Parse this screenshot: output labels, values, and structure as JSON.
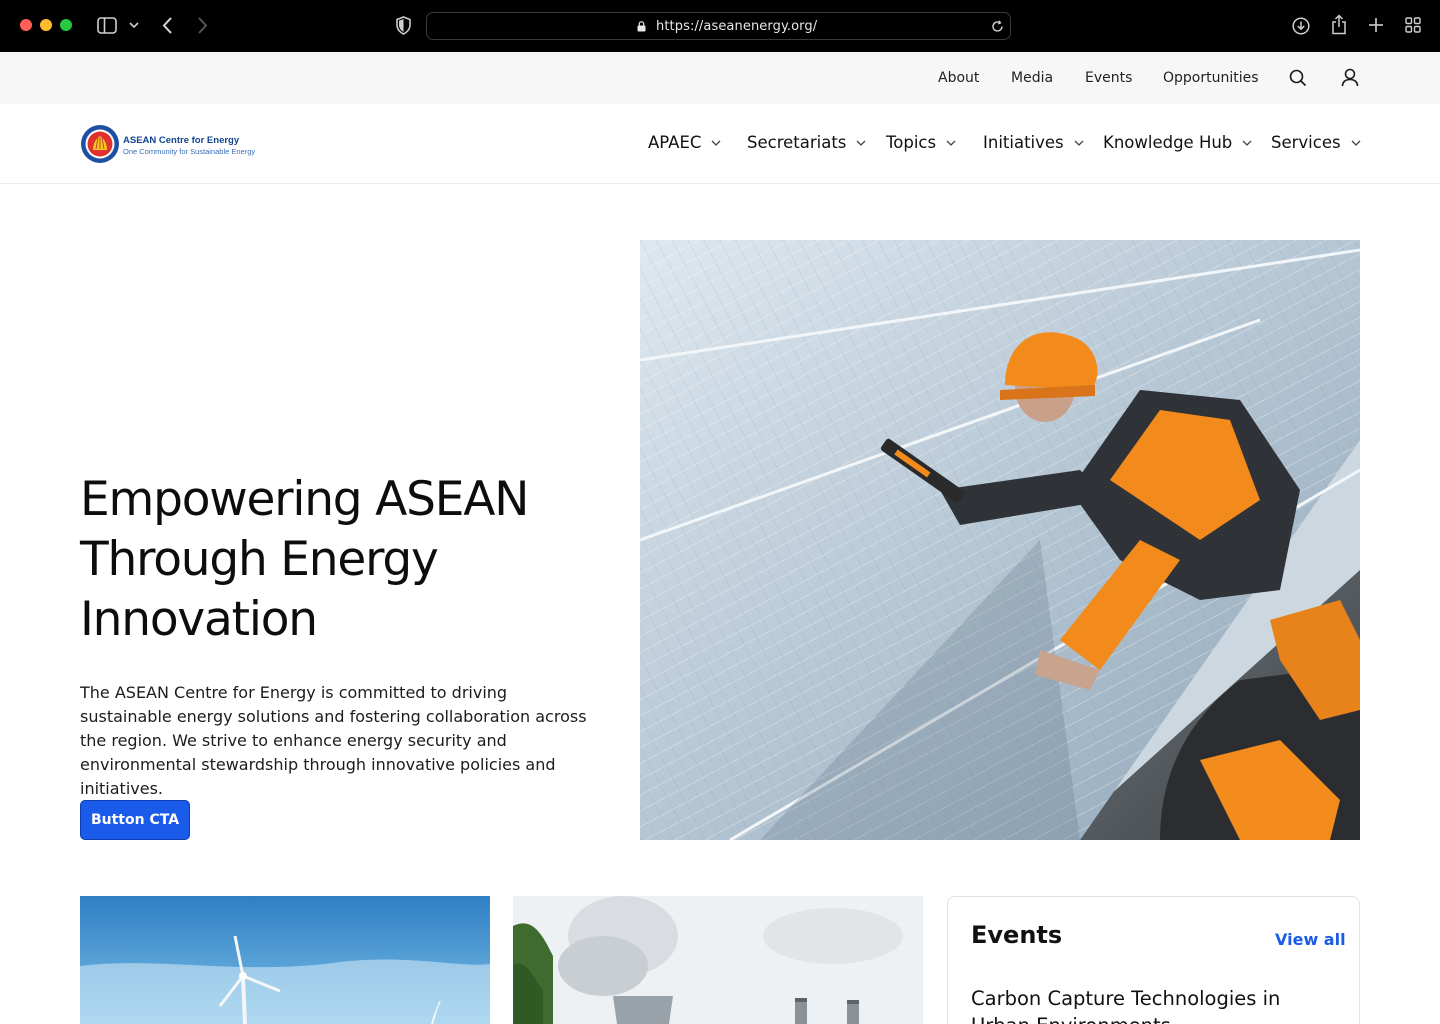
{
  "browser": {
    "url": "https://aseanenergy.org/",
    "icons": [
      "sidebar-icon",
      "chevron-down-icon",
      "back-icon",
      "forward-icon",
      "shield-icon",
      "lock-icon",
      "reload-icon",
      "download-icon",
      "share-icon",
      "plus-icon",
      "tabs-icon"
    ]
  },
  "utility_nav": {
    "items": [
      "About",
      "Media",
      "Events",
      "Opportunities"
    ],
    "icons": [
      "search-icon",
      "user-icon"
    ]
  },
  "logo": {
    "title": "ASEAN Centre for Energy",
    "tagline": "One Community for Sustainable Energy"
  },
  "main_nav": {
    "items": [
      "APAEC",
      "Secretariats",
      "Topics",
      "Initiatives",
      "Knowledge Hub",
      "Services"
    ]
  },
  "hero": {
    "title": "Empowering ASEAN Through Energy Innovation",
    "body": "The ASEAN Centre for Energy is committed to driving sustainable energy solutions and fostering collaboration across the region. We strive to enhance energy security and environmental stewardship through innovative policies and initiatives.",
    "cta_label": "Button CTA"
  },
  "events": {
    "title": "Events",
    "view_all": "View all",
    "items": [
      {
        "title": "Carbon Capture Technologies in Urban Environments"
      }
    ]
  },
  "colors": {
    "accent": "#1b5bea",
    "link": "#1a5ce6",
    "helmet": "#f28a1c"
  }
}
